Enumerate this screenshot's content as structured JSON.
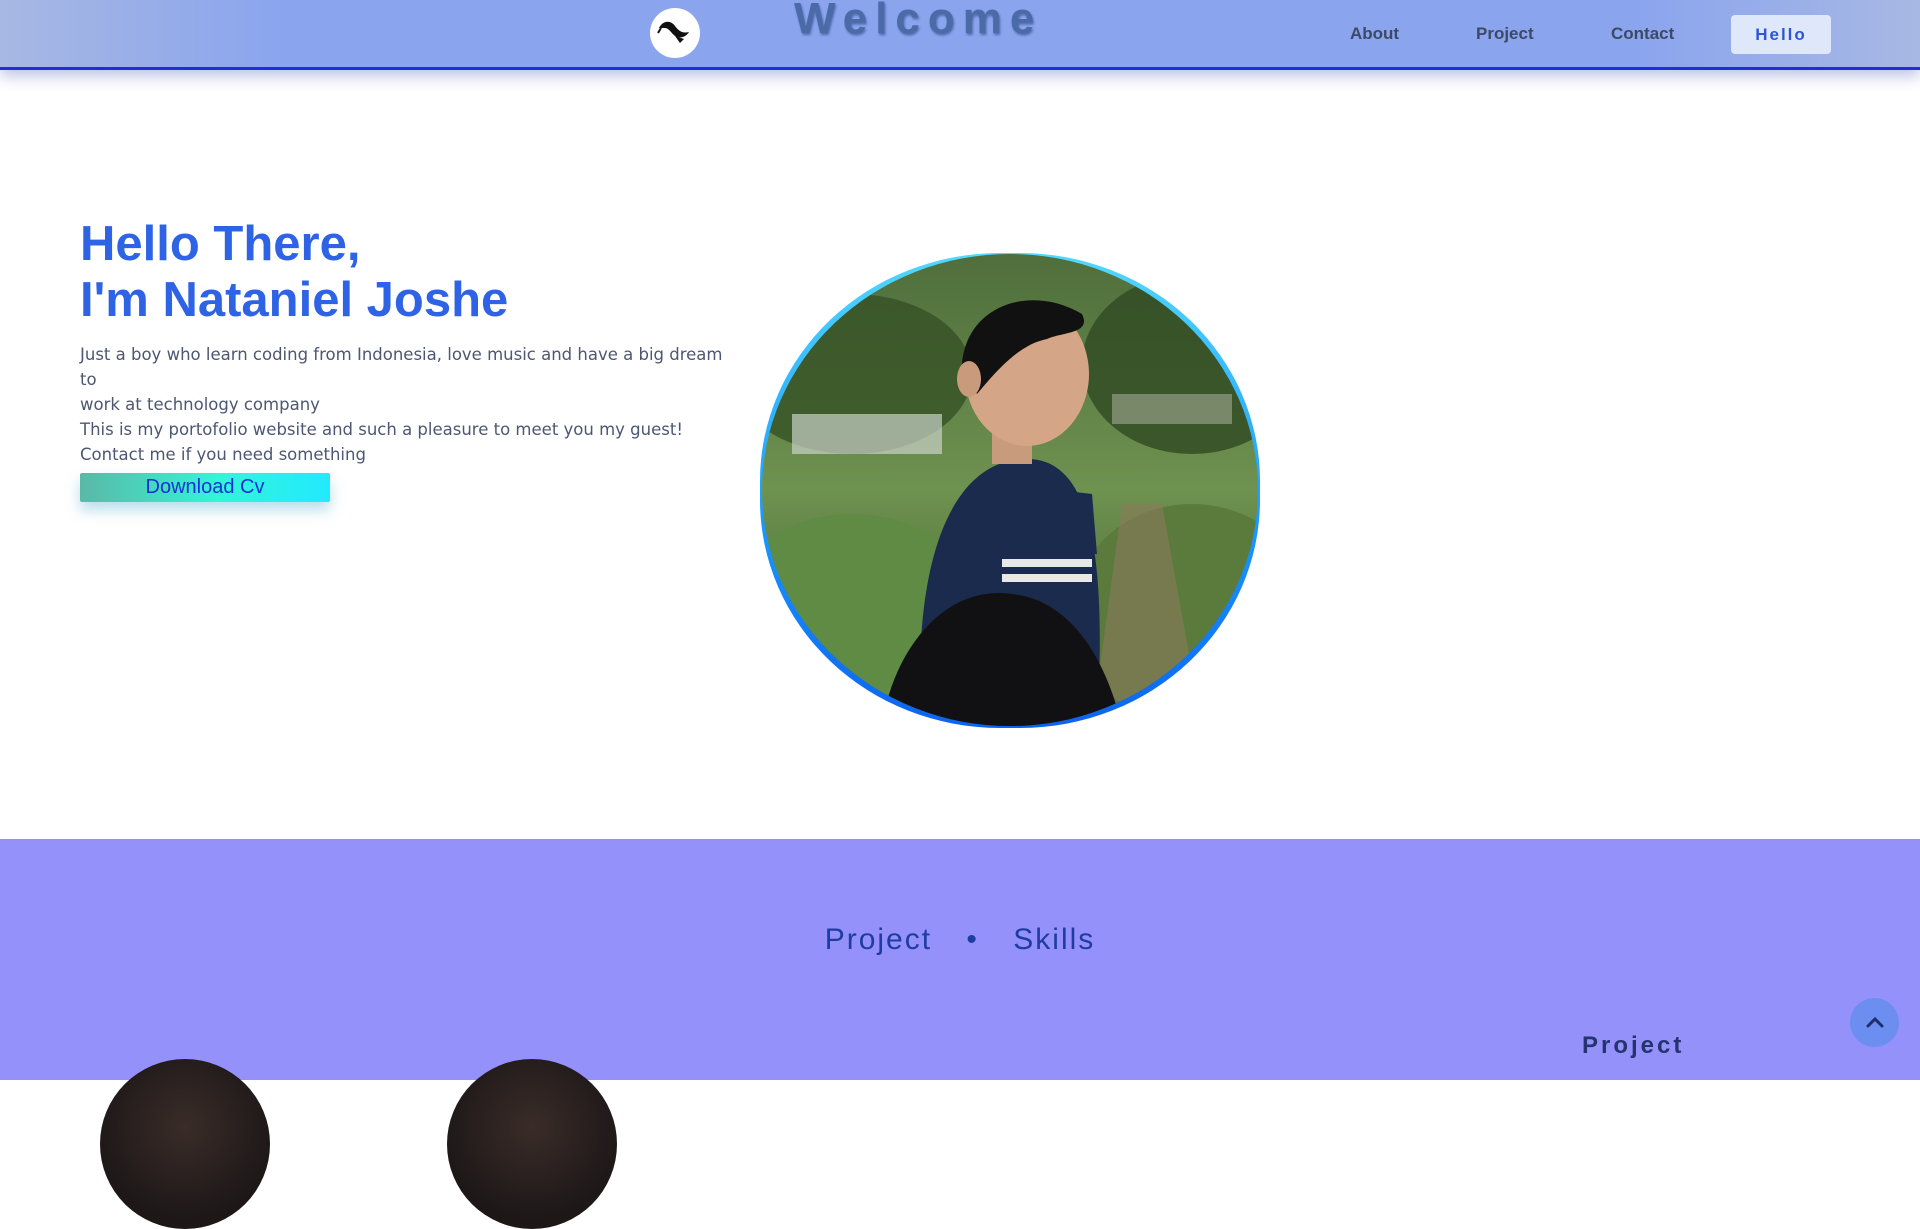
{
  "header": {
    "welcome": "Welcome",
    "nav": [
      "About",
      "Project",
      "Contact"
    ],
    "hello_button": "Hello",
    "logo_icon": "bird-logo-icon"
  },
  "hero": {
    "title_line1": "Hello There,",
    "title_line2": "I'm Nataniel Joshe",
    "desc_line1": "Just a boy who learn coding from Indonesia, love music and have a big dream to",
    "desc_line2": "work at technology company",
    "desc_line3": "This is my portofolio website and such a pleasure to meet you my guest!",
    "desc_line4": "Contact me if you need something",
    "cv_button": "Download Cv"
  },
  "projects": {
    "title_left": "Project",
    "separator": "•",
    "title_right": "Skills",
    "side_title": "Project"
  },
  "scroll_top_icon": "chevron-up-icon",
  "colors": {
    "accent": "#2f63e6",
    "nav_bg": "#8aa4ee",
    "section_bg": "#9491fb"
  }
}
